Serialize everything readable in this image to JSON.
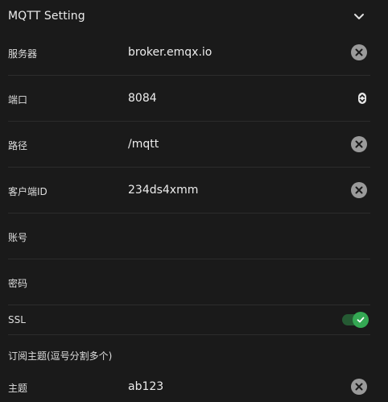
{
  "header": {
    "title": "MQTT Setting",
    "collapse_icon": "chevron-down-icon"
  },
  "fields": {
    "server": {
      "label": "服务器",
      "value": "broker.emqx.io"
    },
    "port": {
      "label": "端口",
      "value": "8084"
    },
    "path": {
      "label": "路径",
      "value": "/mqtt"
    },
    "clientId": {
      "label": "客户端ID",
      "value": "234ds4xmm"
    },
    "account": {
      "label": "账号",
      "value": ""
    },
    "password": {
      "label": "密码",
      "value": ""
    },
    "ssl": {
      "label": "SSL",
      "enabled": true
    },
    "subscribe_section": {
      "label": "订阅主题(逗号分割多个)"
    },
    "topic": {
      "label": "主题",
      "value": "ab123"
    }
  },
  "colors": {
    "background": "#1a1a1a",
    "divider": "#2c2c2c",
    "toggle_on": "#34a853",
    "clear_icon": "#9a9a9a"
  }
}
